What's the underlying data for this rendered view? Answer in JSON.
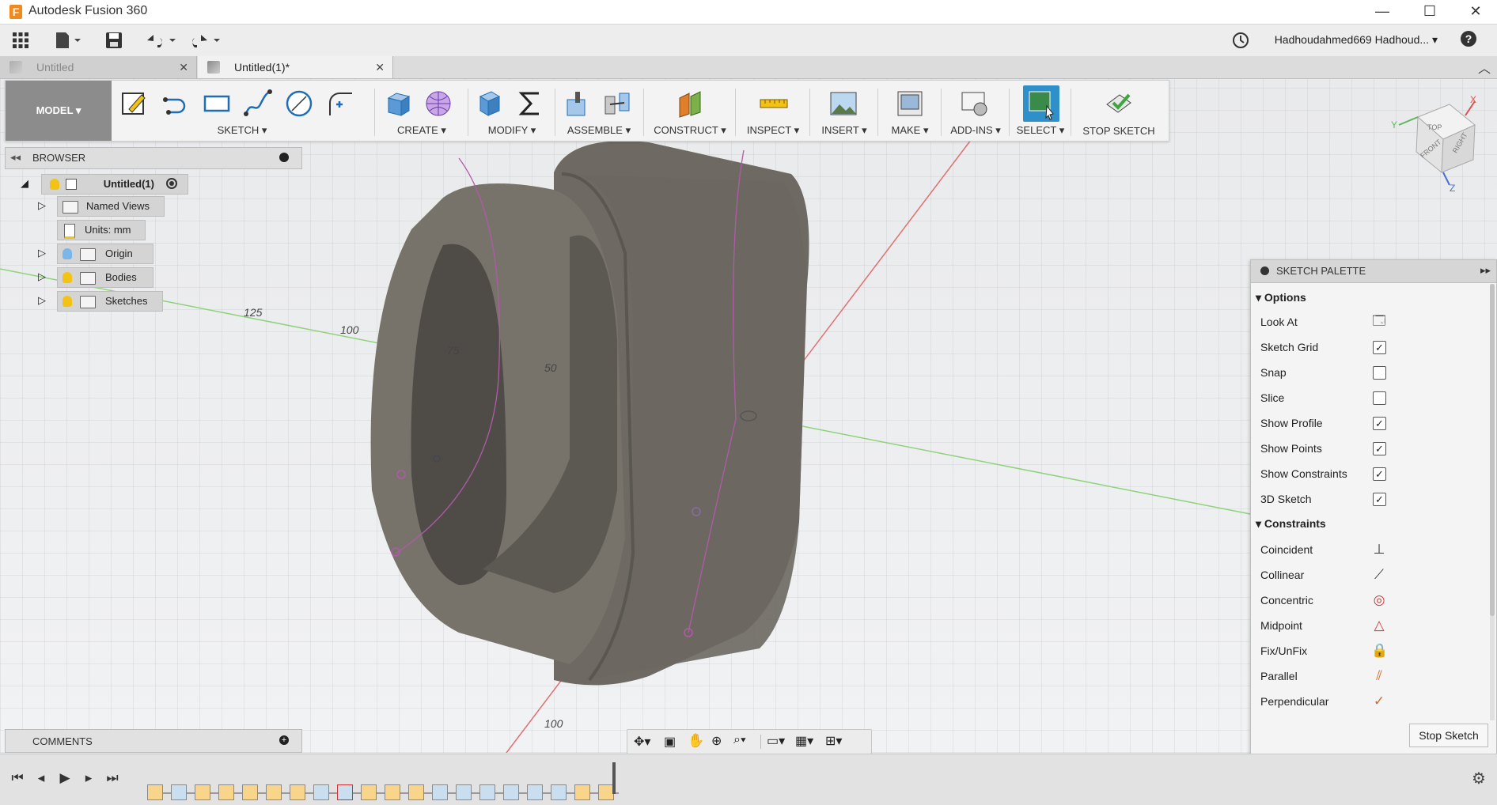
{
  "window": {
    "title": "Autodesk Fusion 360",
    "app_letter": "F",
    "minimize": "—",
    "maximize": "☐",
    "close": "✕"
  },
  "qat": {
    "user": "Hadhoudahmed669 Hadhoud...",
    "help": "?"
  },
  "tabs": [
    {
      "label": "Untitled",
      "active": false
    },
    {
      "label": "Untitled(1)*",
      "active": true
    }
  ],
  "toolbar": {
    "workspace": "MODEL",
    "groups": [
      {
        "label": "SKETCH"
      },
      {
        "label": "CREATE"
      },
      {
        "label": "MODIFY"
      },
      {
        "label": "ASSEMBLE"
      },
      {
        "label": "CONSTRUCT"
      },
      {
        "label": "INSPECT"
      },
      {
        "label": "INSERT"
      },
      {
        "label": "MAKE"
      },
      {
        "label": "ADD-INS"
      },
      {
        "label": "SELECT"
      },
      {
        "label": "STOP SKETCH"
      }
    ]
  },
  "browser": {
    "title": "BROWSER",
    "root": "Untitled(1)",
    "items": [
      {
        "label": "Named Views"
      },
      {
        "label": "Units: mm"
      },
      {
        "label": "Origin"
      },
      {
        "label": "Bodies"
      },
      {
        "label": "Sketches"
      }
    ]
  },
  "comments": {
    "title": "COMMENTS"
  },
  "viewcube": {
    "top": "TOP",
    "front": "FRONT",
    "right": "RIGHT",
    "x": "X",
    "y": "Y",
    "z": "Z"
  },
  "axis_labels": {
    "a125": "125",
    "a100": "100",
    "a75": "75",
    "a50": "50",
    "b100": "100"
  },
  "palette": {
    "title": "SKETCH PALETTE",
    "options_title": "Options",
    "options": [
      {
        "label": "Look At",
        "checked": null
      },
      {
        "label": "Sketch Grid",
        "checked": true
      },
      {
        "label": "Snap",
        "checked": false
      },
      {
        "label": "Slice",
        "checked": false
      },
      {
        "label": "Show Profile",
        "checked": true
      },
      {
        "label": "Show Points",
        "checked": true
      },
      {
        "label": "Show Constraints",
        "checked": true
      },
      {
        "label": "3D Sketch",
        "checked": true
      }
    ],
    "constraints_title": "Constraints",
    "constraints": [
      {
        "label": "Coincident",
        "icon": "coincident-icon"
      },
      {
        "label": "Collinear",
        "icon": "collinear-icon"
      },
      {
        "label": "Concentric",
        "icon": "concentric-icon"
      },
      {
        "label": "Midpoint",
        "icon": "midpoint-icon"
      },
      {
        "label": "Fix/UnFix",
        "icon": "lock-icon"
      },
      {
        "label": "Parallel",
        "icon": "parallel-icon"
      },
      {
        "label": "Perpendicular",
        "icon": "perpendicular-icon"
      }
    ],
    "stop_button": "Stop Sketch"
  },
  "colors": {
    "accent": "#1f6db4",
    "bulb": "#f2c315",
    "bulb_blue": "#7ab7e8",
    "body": "#6f6b64"
  }
}
